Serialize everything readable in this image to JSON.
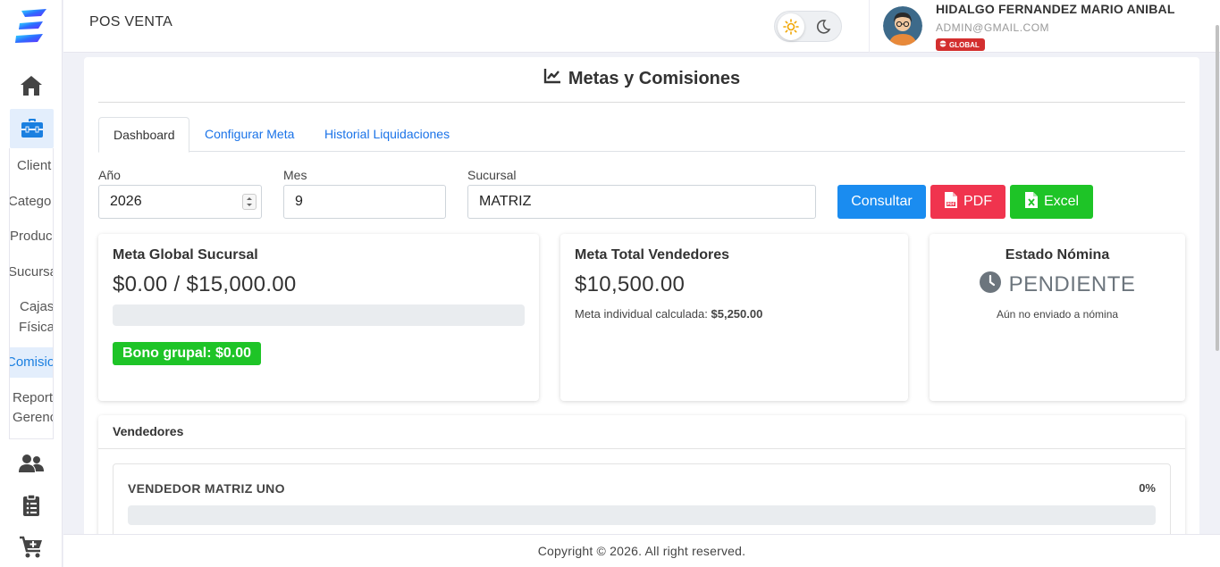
{
  "app": {
    "title": "POS VENTA",
    "copyright": "Copyright © 2026. All right reserved."
  },
  "theme": {
    "light_icon": "sun-icon",
    "dark_icon": "moon-icon"
  },
  "user": {
    "name": "HIDALGO FERNANDEZ MARIO ANIBAL",
    "email": "ADMIN@GMAIL.COM",
    "badge": "GLOBAL"
  },
  "sidebar": {
    "icons": [
      "home-icon",
      "toolbox-icon",
      "users-icon",
      "clipboard-icon",
      "cart-plus-icon"
    ],
    "submenu": [
      "Client",
      "Catego",
      "Produc",
      "Sucursa",
      "Cajas",
      "Física",
      "Comisio",
      "Report",
      "Gerenc"
    ]
  },
  "page": {
    "title": "Metas y Comisiones",
    "title_icon": "line-chart-icon"
  },
  "tabs": [
    "Dashboard",
    "Configurar Meta",
    "Historial Liquidaciones"
  ],
  "filters": {
    "year_label": "Año",
    "year_value": "2026",
    "month_label": "Mes",
    "month_value": "9",
    "branch_label": "Sucursal",
    "branch_value": "MATRIZ"
  },
  "buttons": {
    "consultar": "Consultar",
    "pdf": "PDF",
    "excel": "Excel"
  },
  "colors": {
    "primary": "#1a8cf0",
    "pdf": "#f0344e",
    "excel": "#1ec427",
    "success": "#1ec427"
  },
  "cards": {
    "meta_global": {
      "title": "Meta Global Sucursal",
      "value": "$0.00 / $15,000.00",
      "progress": 0,
      "bono": "Bono grupal: $0.00"
    },
    "meta_total": {
      "title": "Meta Total Vendedores",
      "value": "$10,500.00",
      "individual_label": "Meta individual calculada:",
      "individual_value": "$5,250.00"
    },
    "estado": {
      "title": "Estado Nómina",
      "status": "PENDIENTE",
      "subtitle": "Aún no enviado a nómina"
    }
  },
  "vendedores": {
    "title": "Vendedores",
    "items": [
      {
        "name": "VENDEDOR MATRIZ UNO",
        "percent": "0%",
        "progress": 0
      }
    ]
  }
}
